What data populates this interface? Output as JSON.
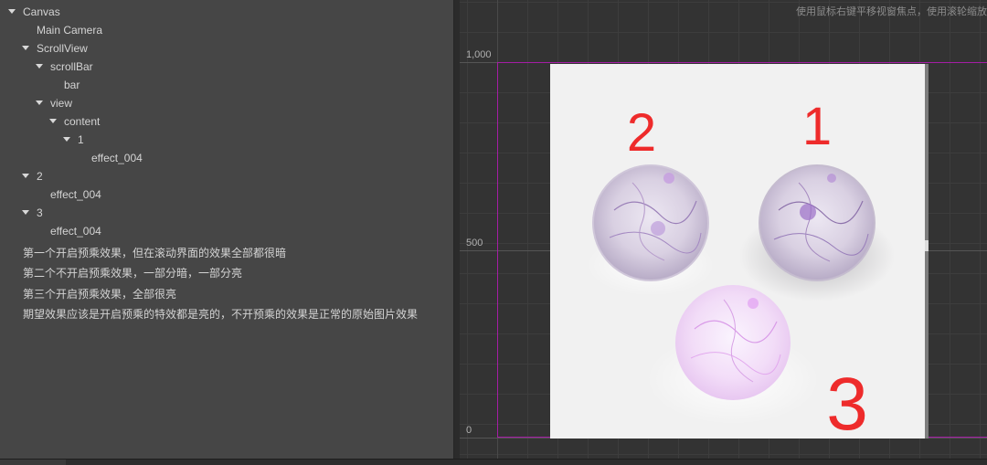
{
  "hierarchy": {
    "nodes": [
      {
        "label": "Canvas",
        "expanded": true
      },
      {
        "label": "Main Camera",
        "expanded": false
      },
      {
        "label": "ScrollView",
        "expanded": true
      },
      {
        "label": "scrollBar",
        "expanded": true
      },
      {
        "label": "bar",
        "expanded": false
      },
      {
        "label": "view",
        "expanded": true
      },
      {
        "label": "content",
        "expanded": true
      },
      {
        "label": "1",
        "expanded": true
      },
      {
        "label": "effect_004",
        "expanded": false
      },
      {
        "label": "2",
        "expanded": true
      },
      {
        "label": "effect_004",
        "expanded": false
      },
      {
        "label": "3",
        "expanded": true
      },
      {
        "label": "effect_004",
        "expanded": false
      }
    ],
    "notes": [
      "第一个开启预乘效果，但在滚动界面的效果全部都很暗",
      "第二个不开启预乘效果，一部分暗，一部分亮",
      "第三个开启预乘效果，全部很亮",
      "期望效果应该是开启预乘的特效都是亮的，不开预乘的效果是正常的原始图片效果"
    ]
  },
  "scene": {
    "hint": "使用鼠标右键平移视窗焦点，使用滚轮缩放",
    "axis_labels": [
      "1,000",
      "500",
      "0"
    ],
    "annotations": [
      "2",
      "1",
      "3"
    ],
    "colors": {
      "frame": "#a51da5",
      "annotation": "#ee2b2b",
      "canvas": "#f1f1f1"
    }
  }
}
